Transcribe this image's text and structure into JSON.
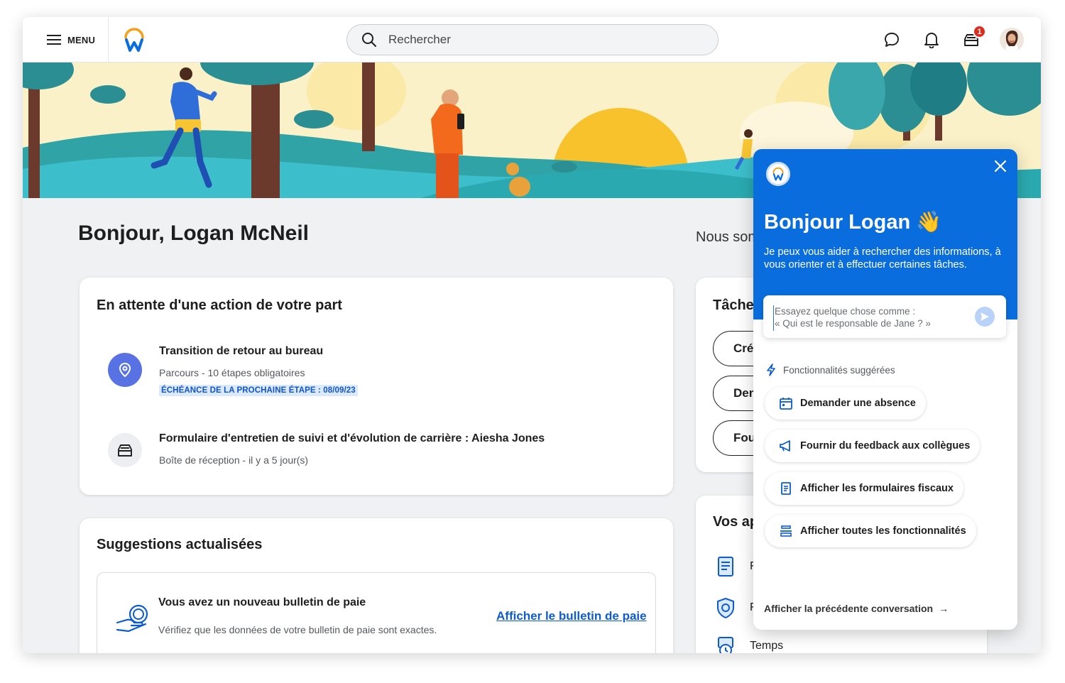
{
  "topbar": {
    "menu_label": "MENU",
    "search_placeholder": "Rechercher",
    "inbox_badge": "1"
  },
  "greeting": "Bonjour, Logan McNeil",
  "side_heading": "Nous sommes",
  "action_card": {
    "title": "En attente d'une action de votre part",
    "items": [
      {
        "title": "Transition de retour au bureau",
        "subtitle": "Parcours - 10 étapes obligatoires",
        "due": "ÉCHÉANCE DE LA PROCHAINE ÉTAPE : 08/09/23",
        "icon": "location-pin-icon"
      },
      {
        "title": "Formulaire d'entretien de suivi et d'évolution de carrière : Aiesha Jones",
        "subtitle": "Boîte de réception - il y a 5  jour(s)",
        "icon": "inbox-tray-icon"
      }
    ]
  },
  "suggestions_card": {
    "title": "Suggestions actualisées",
    "item": {
      "title": "Vous avez un nouveau bulletin de paie",
      "subtitle": "Vérifiez que les données de votre bulletin de paie sont exactes.",
      "link": "Afficher le bulletin de paie",
      "icon": "payslip-icon"
    }
  },
  "tasks_card": {
    "title": "Tâches",
    "buttons": [
      "Créer",
      "Demander",
      "Fournir"
    ]
  },
  "apps_card": {
    "title": "Vos applications",
    "items": [
      "F",
      "F",
      "Temps"
    ]
  },
  "assistant": {
    "hello": "Bonjour Logan 👋",
    "help": "Je peux vous aider à rechercher des informations, à vous orienter et à effectuer certaines tâches.",
    "input_placeholder": "Essayez quelque chose comme :\n« Qui est le responsable de Jane ? »",
    "suggested_heading": "Fonctionnalités suggérées",
    "suggestions": [
      {
        "label": "Demander une absence",
        "icon": "calendar-icon"
      },
      {
        "label": "Fournir du feedback aux collègues",
        "icon": "megaphone-icon"
      },
      {
        "label": "Afficher les formulaires fiscaux",
        "icon": "document-icon"
      },
      {
        "label": "Afficher toutes les fonctionnalités",
        "icon": "stack-icon"
      }
    ],
    "previous_conversation": "Afficher la précédente conversation",
    "arrow": "→"
  },
  "colors": {
    "brand_blue": "#0a6ddd",
    "link_blue": "#0d5bd1",
    "badge_red": "#de2b1e",
    "logo_orange": "#f5a01a"
  }
}
